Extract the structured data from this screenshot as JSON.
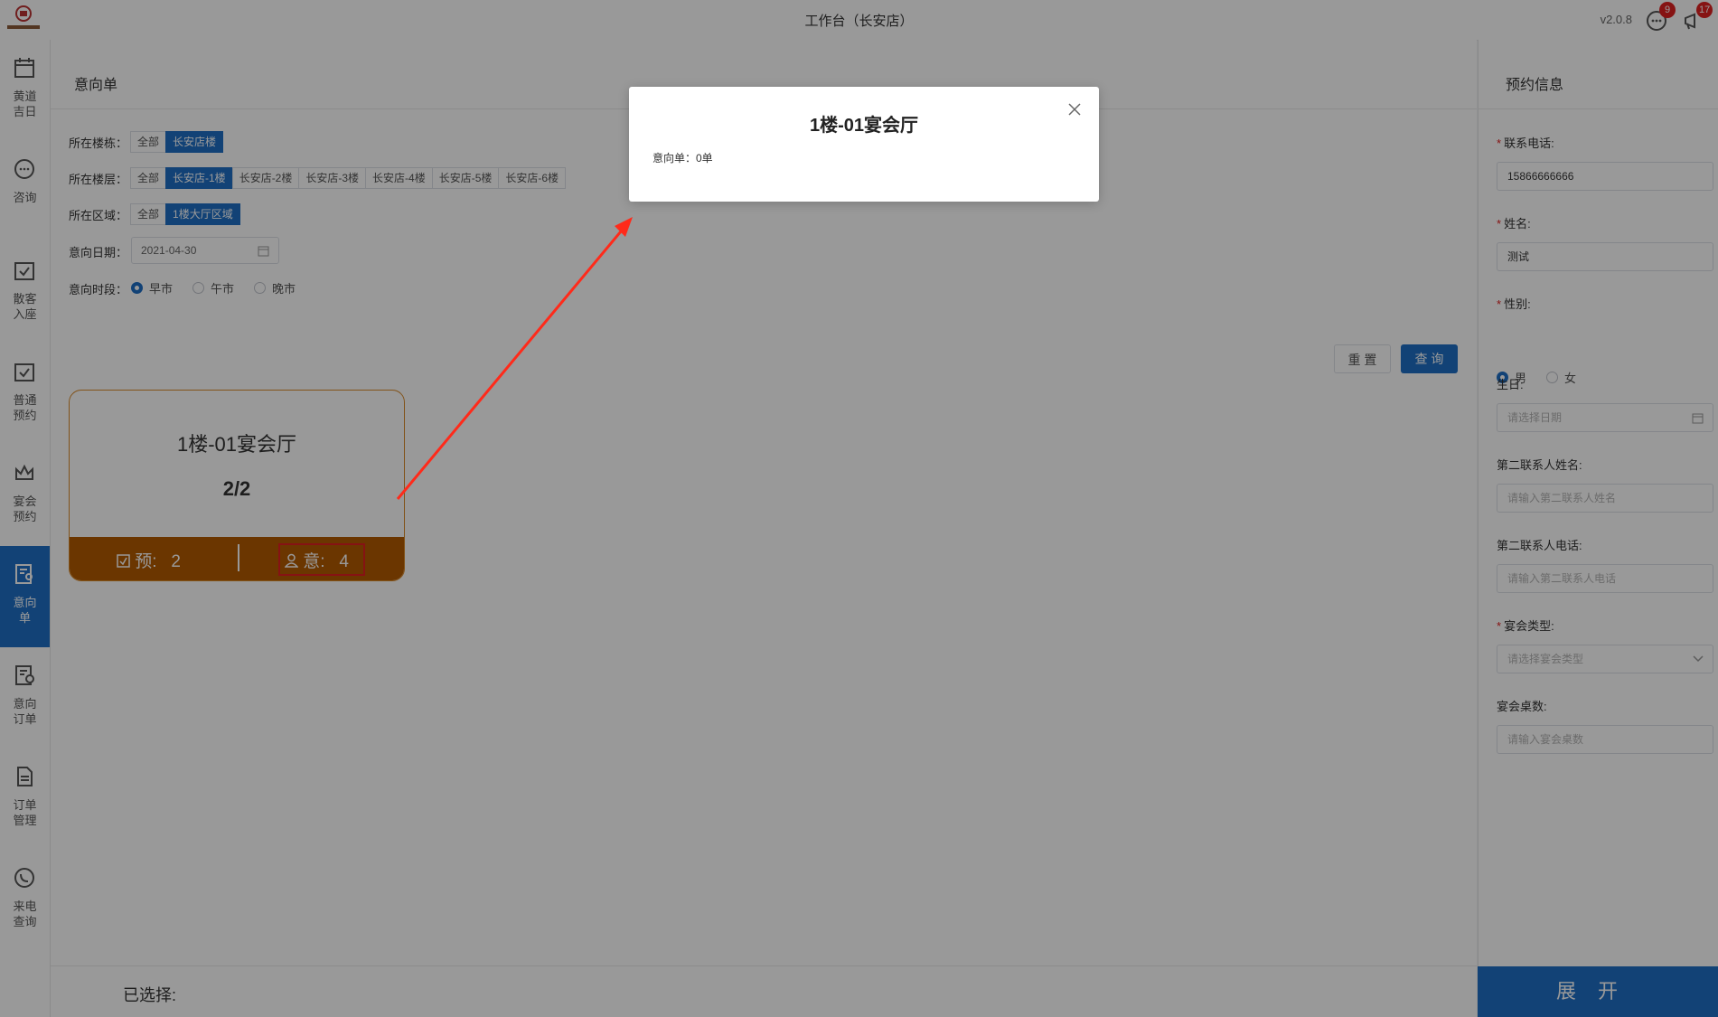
{
  "app": {
    "title": "工作台（长安店）",
    "version": "v2.0.8",
    "messages_badge": "9",
    "notices_badge": "17"
  },
  "sidebar": {
    "items": [
      {
        "label": "黄道\n吉日",
        "icon": "calendar-icon"
      },
      {
        "label": "咨询",
        "icon": "chat-icon"
      },
      {
        "label": "散客\n入座",
        "icon": "calendar-check-icon"
      },
      {
        "label": "普通\n预约",
        "icon": "calendar-check-icon"
      },
      {
        "label": "宴会\n预约",
        "icon": "crown-icon"
      },
      {
        "label": "意向\n单",
        "icon": "document-user-icon"
      },
      {
        "label": "意向\n订单",
        "icon": "document-clock-icon"
      },
      {
        "label": "订单\n管理",
        "icon": "file-icon"
      },
      {
        "label": "来电\n查询",
        "icon": "phone-icon"
      }
    ]
  },
  "main": {
    "title": "意向单",
    "filters": {
      "building_label": "所在楼栋：",
      "building_options": [
        "全部",
        "长安店楼"
      ],
      "floor_label": "所在楼层：",
      "floor_options": [
        "全部",
        "长安店-1楼",
        "长安店-2楼",
        "长安店-3楼",
        "长安店-4楼",
        "长安店-5楼",
        "长安店-6楼"
      ],
      "area_label": "所在区域：",
      "area_options": [
        "全部",
        "1楼大厅区域"
      ],
      "date_label": "意向日期：",
      "date_value": "2021-04-30",
      "period_label": "意向时段：",
      "period_options": [
        "早市",
        "午市",
        "晚市"
      ]
    },
    "reset_label": "重 置",
    "query_label": "查 询",
    "card": {
      "name": "1楼-01宴会厅",
      "count": "2/2",
      "reserved_label": "预:",
      "reserved_value": "2",
      "intent_label": "意:",
      "intent_value": "4"
    },
    "selected_label": "已选择:"
  },
  "right": {
    "title": "预约信息",
    "phone_label": "联系电话:",
    "phone_value": "15866666666",
    "name_label": "姓名:",
    "name_value": "测试",
    "gender_label": "性别:",
    "gender_male": "男",
    "gender_female": "女",
    "birthday_label": "生日:",
    "birthday_placeholder": "请选择日期",
    "contact2_name_label": "第二联系人姓名:",
    "contact2_name_placeholder": "请输入第二联系人姓名",
    "contact2_phone_label": "第二联系人电话:",
    "contact2_phone_placeholder": "请输入第二联系人电话",
    "banquet_type_label": "宴会类型:",
    "banquet_type_placeholder": "请选择宴会类型",
    "tables_label": "宴会桌数:",
    "tables_placeholder": "请输入宴会桌数",
    "expand_label": "展开"
  },
  "modal": {
    "title": "1楼-01宴会厅",
    "body": "意向单：0单"
  },
  "colors": {
    "primary": "#1f6fc5",
    "card_footer": "#b35a00",
    "highlight": "#e02020"
  }
}
